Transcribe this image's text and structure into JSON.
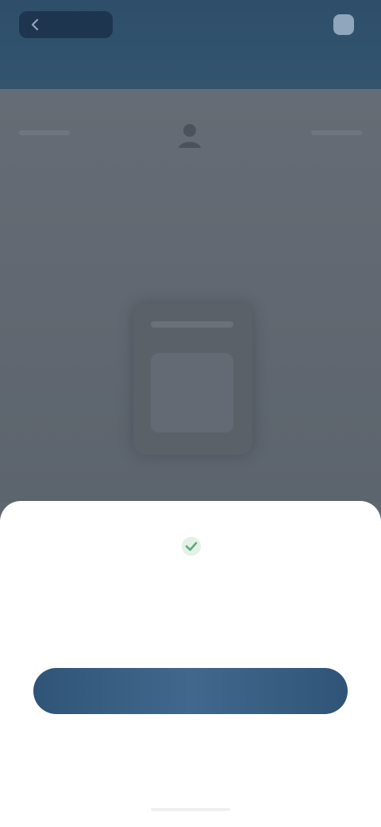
{
  "header": {
    "back_label": "",
    "action_label": "",
    "back_icon": "chevron-left-icon",
    "action_icon": "app-icon"
  },
  "page": {
    "profile_icon": "user-icon",
    "profile_label": ""
  },
  "sheet": {
    "icon": "check-icon",
    "message": "",
    "primary_button_label": "",
    "secondary_link_label": ""
  },
  "colors": {
    "header_bg": "#2e4e6a",
    "overlay_bg": "#5f6770",
    "sheet_bg": "#ffffff",
    "primary_button": "#33587c",
    "accent_green": "#5fa978"
  }
}
